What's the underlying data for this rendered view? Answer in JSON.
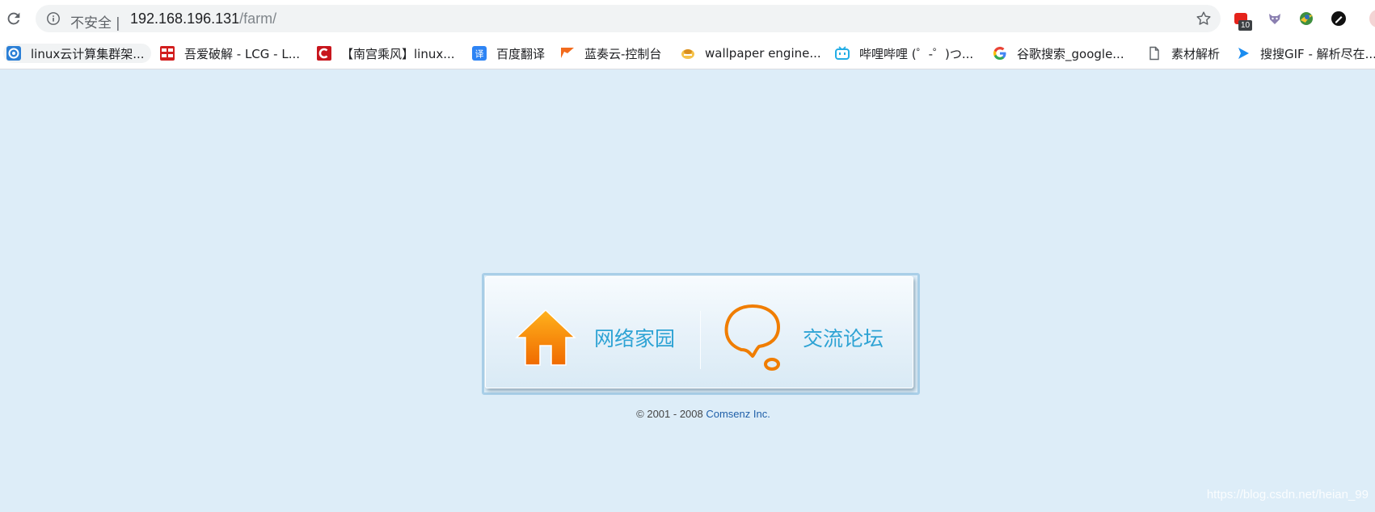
{
  "browser": {
    "security_label": "不安全",
    "separator": "|",
    "url_host": "192.168.196.131",
    "url_path": "/farm/",
    "extension_badge": "10",
    "bookmarks": [
      {
        "label": "linux云计算集群架...",
        "icon": "circle-globe-icon"
      },
      {
        "label": "吾爱破解 - LCG - L...",
        "icon": "52pojie-icon"
      },
      {
        "label": "【南宫乘风】linux...",
        "icon": "csdn-icon"
      },
      {
        "label": "百度翻译",
        "icon": "baidu-translate-icon"
      },
      {
        "label": "蓝奏云-控制台",
        "icon": "lanzou-icon"
      },
      {
        "label": "wallpaper engine...",
        "icon": "wallpaper-engine-icon"
      },
      {
        "label": "哔哩哔哩 (゜-゜)つ...",
        "icon": "bilibili-icon"
      },
      {
        "label": "谷歌搜索_google...",
        "icon": "google-icon"
      },
      {
        "label": "素材解析",
        "icon": "document-icon"
      },
      {
        "label": "搜搜GIF - 解析尽在...",
        "icon": "play-icon"
      }
    ]
  },
  "main": {
    "home_label": "网络家园",
    "forum_label": "交流论坛"
  },
  "footer": {
    "copyright": "© 2001 - 2008 ",
    "company": "Comsenz Inc."
  },
  "watermark": "https://blog.csdn.net/heian_99",
  "colors": {
    "page_bg": "#ddedf8",
    "link_blue": "#2ea3d4",
    "icon_orange": "#f07d00"
  }
}
